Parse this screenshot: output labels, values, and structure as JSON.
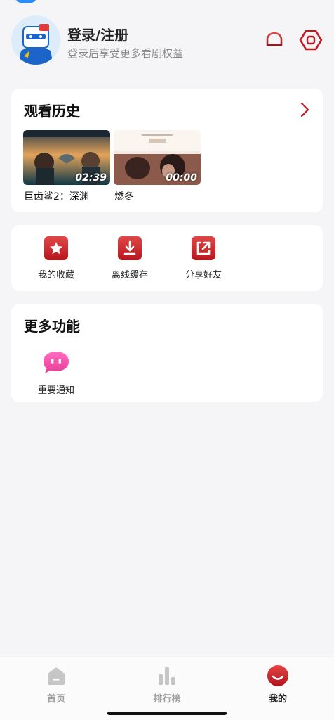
{
  "header": {
    "title": "登录/注册",
    "subtitle": "登录后享受更多看剧权益",
    "bell_icon": "bell-icon",
    "settings_icon": "hexagon-settings-icon"
  },
  "history": {
    "title": "观看历史",
    "items": [
      {
        "caption": "巨齿鲨2：深渊",
        "time": "02:39"
      },
      {
        "caption": "燃冬",
        "time": "00:00"
      }
    ]
  },
  "actions": [
    {
      "label": "我的收藏",
      "icon": "star-icon"
    },
    {
      "label": "离线缓存",
      "icon": "download-icon"
    },
    {
      "label": "分享好友",
      "icon": "share-icon"
    }
  ],
  "more": {
    "title": "更多功能",
    "items": [
      {
        "label": "重要通知",
        "icon": "chat-bubble-icon"
      }
    ]
  },
  "tabbar": {
    "tabs": [
      {
        "label": "首页"
      },
      {
        "label": "排行榜"
      },
      {
        "label": "我的"
      }
    ]
  },
  "colors": {
    "accent": "#c4161c",
    "pink": "#f24ea6",
    "background": "#f5f5f7"
  }
}
